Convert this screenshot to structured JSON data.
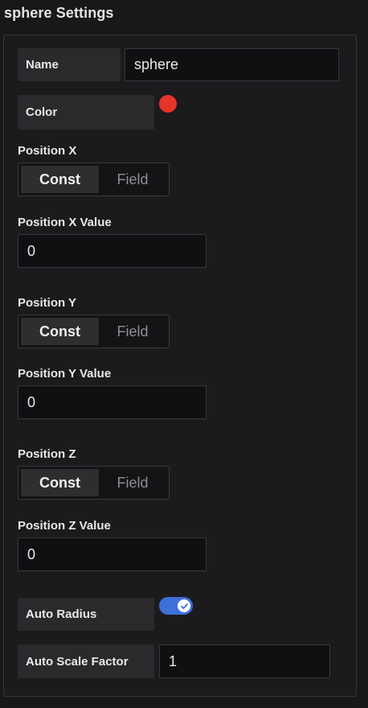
{
  "panel": {
    "title": "sphere Settings"
  },
  "name": {
    "label": "Name",
    "value": "sphere"
  },
  "color": {
    "label": "Color",
    "value": "#e5352a"
  },
  "position_x": {
    "label": "Position X",
    "options": [
      "Const",
      "Field"
    ],
    "selected": "Const",
    "value_label": "Position X Value",
    "value": "0"
  },
  "position_y": {
    "label": "Position Y",
    "options": [
      "Const",
      "Field"
    ],
    "selected": "Const",
    "value_label": "Position Y Value",
    "value": "0"
  },
  "position_z": {
    "label": "Position Z",
    "options": [
      "Const",
      "Field"
    ],
    "selected": "Const",
    "value_label": "Position Z Value",
    "value": "0"
  },
  "auto_radius": {
    "label": "Auto Radius",
    "enabled": true,
    "toggle_color": "#3f6fd8"
  },
  "auto_scale_factor": {
    "label": "Auto Scale Factor",
    "value": "1"
  }
}
